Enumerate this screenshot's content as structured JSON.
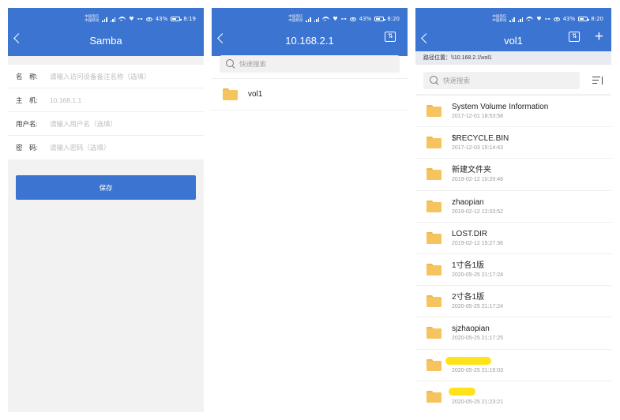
{
  "status": {
    "carrier_line1": "中国电信",
    "carrier_line2": "中国移动",
    "battery": "43%",
    "screens": [
      {
        "time": "8:19"
      },
      {
        "time": "8:20"
      },
      {
        "time": "8:20"
      }
    ]
  },
  "screen1": {
    "title": "Samba",
    "fields": [
      {
        "label": "名　称:",
        "placeholder": "请输入访问设备备注名称（选填）",
        "value": ""
      },
      {
        "label": "主　机:",
        "placeholder": "",
        "value": "10.168.1.1"
      },
      {
        "label": "用户名:",
        "placeholder": "请输入用户名（选填）",
        "value": ""
      },
      {
        "label": "密　码:",
        "placeholder": "请输入密码（选填）",
        "value": ""
      }
    ],
    "save_label": "保存"
  },
  "screen2": {
    "title": "10.168.2.1",
    "search_placeholder": "快速搜索",
    "items": [
      {
        "name": "vol1"
      }
    ]
  },
  "screen3": {
    "title": "vol1",
    "path_label": "路径位置：\\\\10.168.2.1\\vol1",
    "search_placeholder": "快速搜索",
    "items": [
      {
        "name": "System Volume Information",
        "date": "2017-12-01 18:53:58"
      },
      {
        "name": "$RECYCLE.BIN",
        "date": "2017-12-03 15:14:43"
      },
      {
        "name": "新建文件夹",
        "date": "2019-02-12 10:20:46"
      },
      {
        "name": "zhaopian",
        "date": "2019-02-12 12:03:52"
      },
      {
        "name": "LOST.DIR",
        "date": "2019-02-12 15:27:36"
      },
      {
        "name": "1寸各1版",
        "date": "2020-05-25 21:17:24"
      },
      {
        "name": "2寸各1版",
        "date": "2020-05-25 21:17:24"
      },
      {
        "name": "sjzhaopian",
        "date": "2020-05-25 21:17:25"
      },
      {
        "name": "",
        "date": "2020-05-25 21:19:03"
      },
      {
        "name": "",
        "date": "2020-05-25 21:23:21"
      }
    ]
  },
  "colors": {
    "accent": "#3c74d1",
    "folder": "#f5c45f",
    "redaction": "#ffe21a"
  }
}
